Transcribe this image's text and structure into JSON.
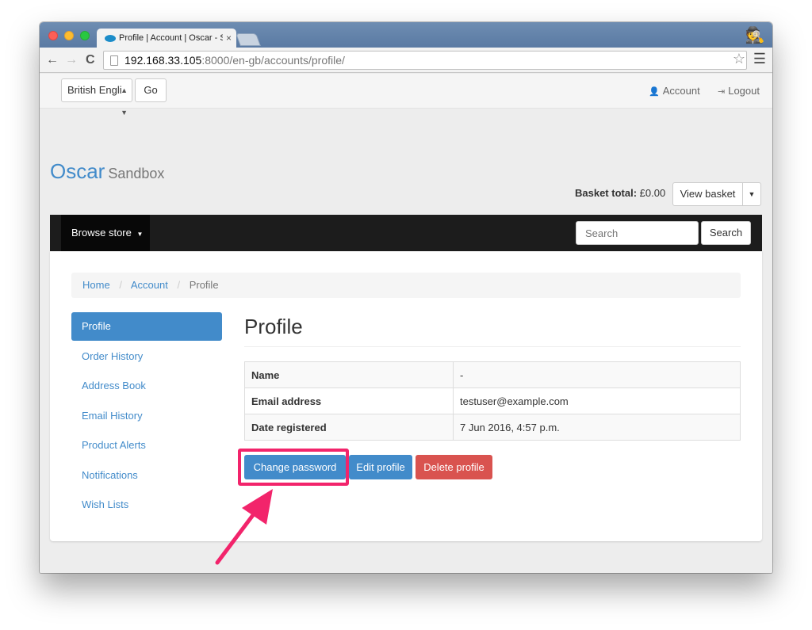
{
  "browser": {
    "tab_title": "Profile | Account | Oscar - S",
    "tab_close": "×",
    "url_host": "192.168.33.105",
    "url_path": ":8000/en-gb/accounts/profile/"
  },
  "topbar": {
    "language": "British Engli",
    "go_label": "Go",
    "account_label": "Account",
    "logout_label": "Logout"
  },
  "header": {
    "brand": "Oscar",
    "brand_sub": "Sandbox",
    "basket_total_label": "Basket total:",
    "basket_total_value": "£0.00",
    "view_basket_label": "View basket"
  },
  "navbar": {
    "browse_store_label": "Browse store",
    "search_placeholder": "Search",
    "search_button": "Search"
  },
  "breadcrumb": {
    "home": "Home",
    "account": "Account",
    "current": "Profile",
    "separator": "/"
  },
  "sidebar": {
    "items": [
      {
        "label": "Profile"
      },
      {
        "label": "Order History"
      },
      {
        "label": "Address Book"
      },
      {
        "label": "Email History"
      },
      {
        "label": "Product Alerts"
      },
      {
        "label": "Notifications"
      },
      {
        "label": "Wish Lists"
      }
    ]
  },
  "main": {
    "title": "Profile",
    "rows": [
      {
        "label": "Name",
        "value": "-"
      },
      {
        "label": "Email address",
        "value": "testuser@example.com"
      },
      {
        "label": "Date registered",
        "value": "7 Jun 2016, 4:57 p.m."
      }
    ],
    "change_password_label": "Change password",
    "edit_profile_label": "Edit profile",
    "delete_profile_label": "Delete profile"
  },
  "colors": {
    "primary": "#428bca",
    "danger": "#d9534f",
    "annotation": "#f2246b"
  }
}
